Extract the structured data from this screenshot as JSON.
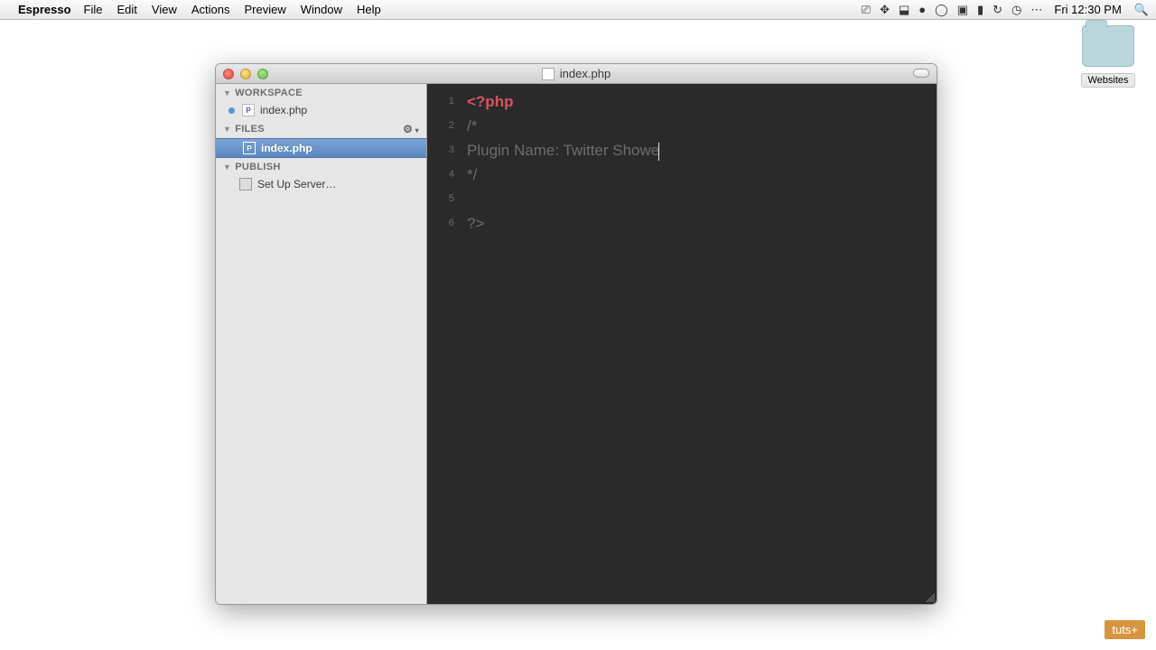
{
  "menubar": {
    "app": "Espresso",
    "items": [
      "File",
      "Edit",
      "View",
      "Actions",
      "Preview",
      "Window",
      "Help"
    ],
    "clock": "Fri 12:30 PM"
  },
  "desktop": {
    "folder_label": "Websites"
  },
  "window": {
    "title": "index.php",
    "sidebar": {
      "workspace_header": "WORKSPACE",
      "workspace_file": "index.php",
      "files_header": "FILES",
      "files_selected": "index.php",
      "publish_header": "PUBLISH",
      "publish_item": "Set Up Server…"
    },
    "editor": {
      "line_numbers": [
        "1",
        "2",
        "3",
        "4",
        "5",
        "6"
      ],
      "lines": [
        {
          "php_tag": "<?php"
        },
        {
          "comment": "/*"
        },
        {
          "comment": "Plugin Name: Twitter Showe",
          "cursor": true
        },
        {
          "comment": "*/"
        },
        {
          "blank": ""
        },
        {
          "php_close": "?>"
        }
      ]
    }
  },
  "badge": "tuts+"
}
